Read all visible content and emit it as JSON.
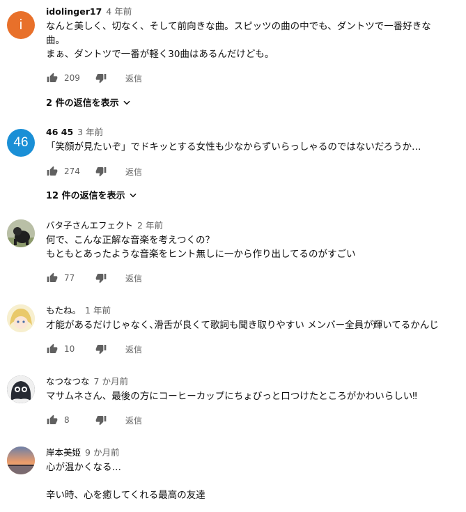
{
  "colors": {
    "text": "#0f0f0f",
    "secondary": "#606060",
    "icon": "#606060",
    "avatar_orange": "#e8702a",
    "avatar_blue": "#1a8fd6"
  },
  "comments": [
    {
      "author": "idolinger17",
      "time": "4 年前",
      "avatar": "i",
      "lines": [
        "なんと美しく、切なく、そして前向きな曲。スピッツの曲の中でも、ダントツで一番好きな",
        "曲。",
        "まぁ、ダントツで一番が軽く30曲はあるんだけども。"
      ],
      "likes": "209",
      "reply": "返信",
      "replies": "2 件の返信を表示"
    },
    {
      "author": "46 45",
      "time": "3 年前",
      "avatar": "46",
      "lines": [
        "「笑顔が見たいぞ」でドキッとする女性も少なからずいらっしゃるのではないだろうか…"
      ],
      "likes": "274",
      "reply": "返信",
      "replies": "12 件の返信を表示"
    },
    {
      "author": "バタ子さんエフェクト",
      "time": "2 年前",
      "lines": [
        "何で、こんな正解な音楽を考えつくの？",
        "もともとあったような音楽をヒント無しに一から作り出してるのがすごい"
      ],
      "likes": "77",
      "reply": "返信"
    },
    {
      "author": "もたね。",
      "time": "1 年前",
      "lines": [
        "才能があるだけじゃなく､滑舌が良くて歌詞も聞き取りやすい メンバー全員が輝いてるかんじ"
      ],
      "likes": "10",
      "reply": "返信"
    },
    {
      "author": "なつなつな",
      "time": "7 か月前",
      "lines": [
        "マサムネさん、最後の方にコーヒーカップにちょびっと口つけたところがかわいらしい‼︎"
      ],
      "likes": "8",
      "reply": "返信"
    },
    {
      "author": "岸本美姫",
      "time": "9 か月前",
      "lines": [
        "心が温かくなる…",
        "",
        "辛い時、心を癒してくれる最高の友達"
      ]
    }
  ]
}
